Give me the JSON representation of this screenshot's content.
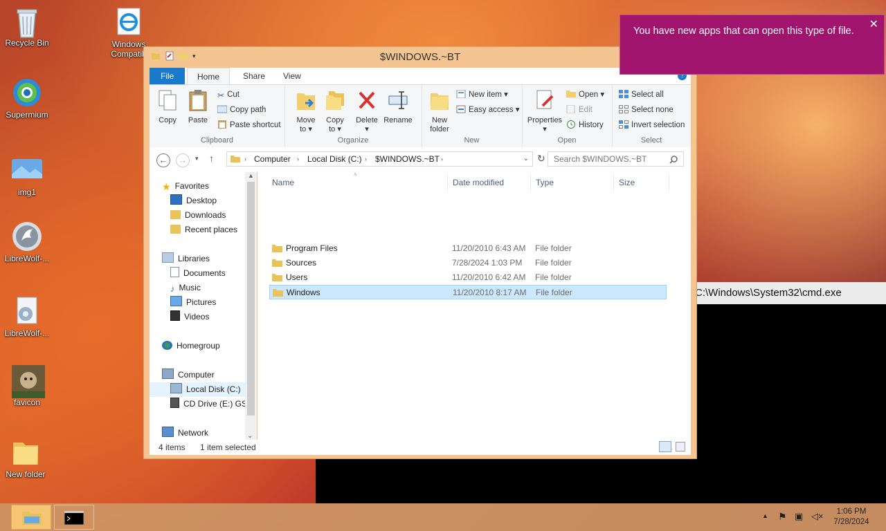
{
  "desktop": {
    "icons": [
      {
        "label": "Recycle Bin"
      },
      {
        "label": "Supermium"
      },
      {
        "label": "img1"
      },
      {
        "label": "LibreWolf-..."
      },
      {
        "label": "LibreWolf-..."
      },
      {
        "label": "favicon"
      },
      {
        "label": "New folder"
      },
      {
        "label": "Windows Compatib"
      }
    ]
  },
  "cmd": {
    "title": "C:\\Windows\\System32\\cmd.exe"
  },
  "explorer": {
    "title": "$WINDOWS.~BT",
    "tabs": {
      "file": "File",
      "home": "Home",
      "share": "Share",
      "view": "View"
    },
    "ribbon": {
      "clipboard": {
        "label": "Clipboard",
        "copy": "Copy",
        "paste": "Paste",
        "cut": "Cut",
        "copy_path": "Copy path",
        "paste_shortcut": "Paste shortcut"
      },
      "organize": {
        "label": "Organize",
        "move_to": "Move",
        "move_to2": "to ▾",
        "copy_to": "Copy",
        "copy_to2": "to ▾",
        "delete": "Delete",
        "delete2": "▾",
        "rename": "Rename"
      },
      "new": {
        "label": "New",
        "new_folder": "New",
        "new_folder2": "folder",
        "new_item": "New item ▾",
        "easy_access": "Easy access ▾"
      },
      "open": {
        "label": "Open",
        "properties": "Properties",
        "properties2": "▾",
        "open": "Open ▾",
        "edit": "Edit",
        "history": "History"
      },
      "select": {
        "label": "Select",
        "select_all": "Select all",
        "select_none": "Select none",
        "invert_selection": "Invert selection"
      }
    },
    "address": {
      "crumbs": [
        "Computer",
        "Local Disk (C:)",
        "$WINDOWS.~BT"
      ],
      "search_placeholder": "Search $WINDOWS.~BT"
    },
    "nav": {
      "favorites": "Favorites",
      "desktop": "Desktop",
      "downloads": "Downloads",
      "recent": "Recent places",
      "libraries": "Libraries",
      "documents": "Documents",
      "music": "Music",
      "pictures": "Pictures",
      "videos": "Videos",
      "homegroup": "Homegroup",
      "computer": "Computer",
      "local_disk": "Local Disk (C:)",
      "cd_drive": "CD Drive (E:) GSP",
      "network": "Network"
    },
    "columns": {
      "name": "Name",
      "date": "Date modified",
      "type": "Type",
      "size": "Size"
    },
    "files": [
      {
        "name": "Program Files",
        "date": "11/20/2010 6:43 AM",
        "type": "File folder",
        "selected": false
      },
      {
        "name": "Sources",
        "date": "7/28/2024 1:03 PM",
        "type": "File folder",
        "selected": false
      },
      {
        "name": "Users",
        "date": "11/20/2010 6:42 AM",
        "type": "File folder",
        "selected": false
      },
      {
        "name": "Windows",
        "date": "11/20/2010 8:17 AM",
        "type": "File folder",
        "selected": true
      }
    ],
    "status": {
      "count": "4 items",
      "selected": "1 item selected"
    }
  },
  "toast": {
    "message": "You have new apps that can open this type of file."
  },
  "taskbar": {
    "time": "1:06 PM",
    "date": "7/28/2024"
  }
}
